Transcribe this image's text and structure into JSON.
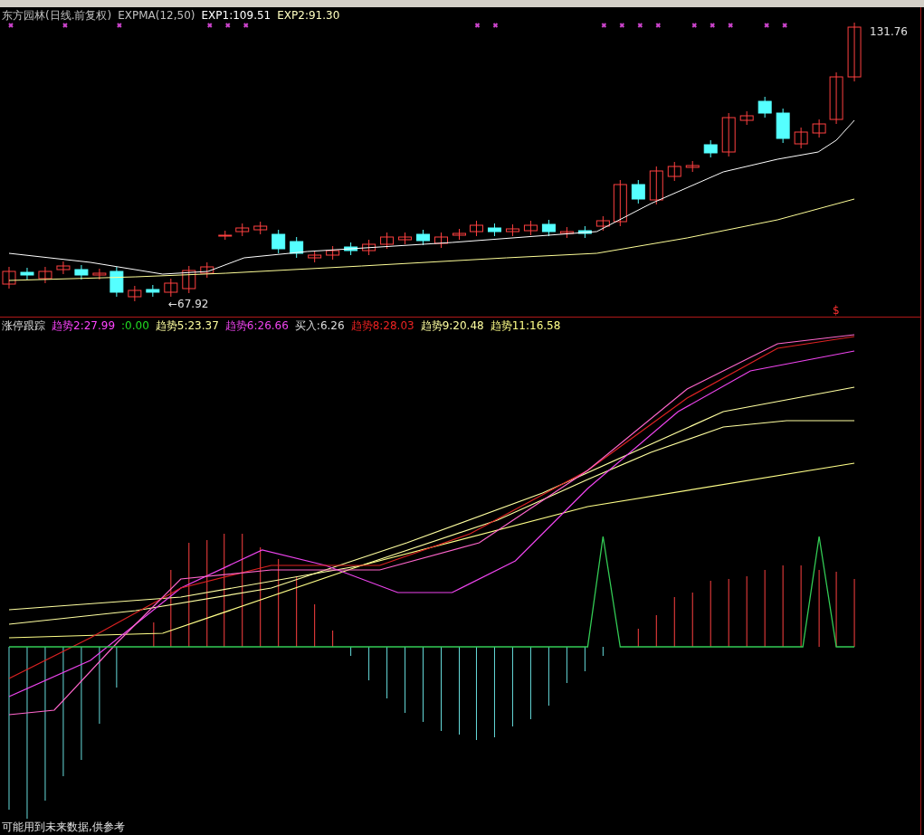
{
  "price_panel": {
    "legend": [
      {
        "text": "东方园林(日线.前复权)",
        "color": "#c0c0c0"
      },
      {
        "text": "EXPMA(12,50)",
        "color": "#c0c0c0"
      },
      {
        "text": "EXP1:109.51",
        "color": "#ffffff"
      },
      {
        "text": "EXP2:91.30",
        "color": "#ffffc0"
      }
    ],
    "high_label": "131.76",
    "low_label": "←67.92",
    "signal_mark": "$"
  },
  "indicator_panel": {
    "title": "涨停跟踪",
    "legend": [
      {
        "text": "趋势2:27.99",
        "color": "#ff44ff"
      },
      {
        "text": ":0.00",
        "color": "#22dd22"
      },
      {
        "text": "趋势5:23.37",
        "color": "#ffffa0"
      },
      {
        "text": "趋势6:26.66",
        "color": "#ee44ee"
      },
      {
        "text": "买入:6.26",
        "color": "#dddddd"
      },
      {
        "text": "趋势8:28.03",
        "color": "#ee2222"
      },
      {
        "text": "趋势9:20.48",
        "color": "#ffffa0"
      },
      {
        "text": "趋势11:16.58",
        "color": "#ffff88"
      }
    ]
  },
  "footer_note": "可能用到未来数据,供参考"
}
